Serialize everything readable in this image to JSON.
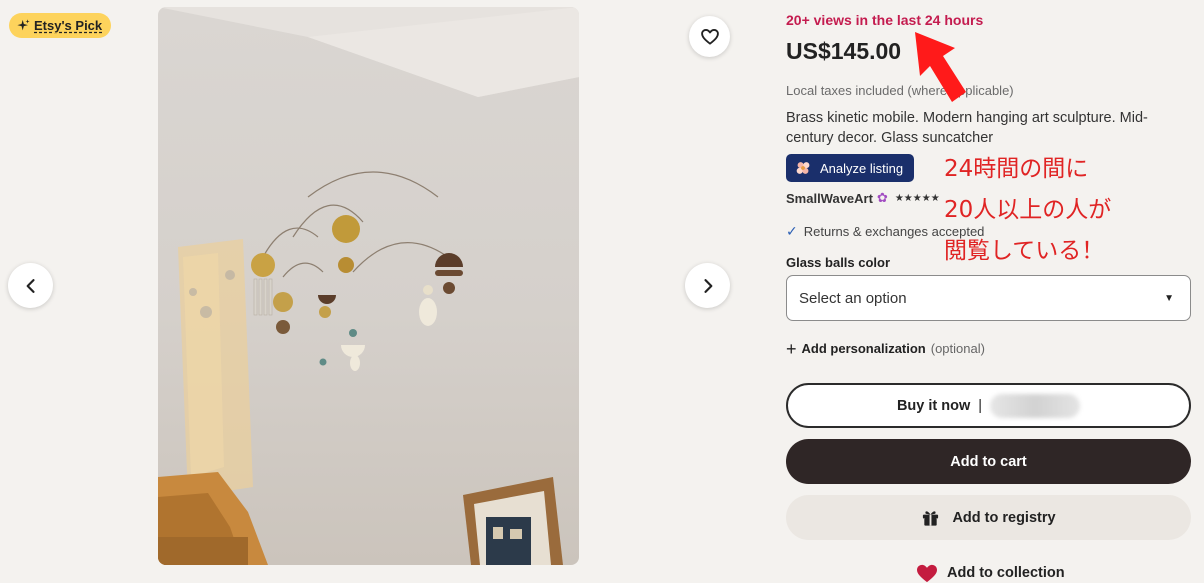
{
  "badge": {
    "label": "Etsy's Pick",
    "icon": "sparkle-icon"
  },
  "gallery": {
    "favorite_icon": "heart-outline-icon",
    "prev_icon": "chevron-left-icon",
    "next_icon": "chevron-right-icon"
  },
  "listing": {
    "views": "20+ views in the last 24 hours",
    "price": "US$145.00",
    "taxes": "Local taxes included (where applicable)",
    "title": "Brass kinetic mobile. Modern hanging art sculpture. Mid-century decor. Glass suncatcher",
    "analyze_label": "Analyze listing",
    "shop_name": "SmallWaveArt",
    "stars": "★★★★★",
    "returns": "Returns & exchanges accepted"
  },
  "options": {
    "label": "Glass balls color",
    "selected": "Select an option"
  },
  "personalization": {
    "label": "Add personalization",
    "optional": "(optional)"
  },
  "actions": {
    "buy_now": "Buy it now",
    "buy_now_sep": "|",
    "add_to_cart": "Add to cart",
    "add_to_registry": "Add to registry",
    "add_to_collection": "Add to collection"
  },
  "annotation": {
    "line1": "24時間の間に",
    "line2": "20人以上の人が",
    "line3": "閲覧している！"
  },
  "colors": {
    "views_red": "#c41c4f",
    "badge_yellow": "#fdd35c",
    "analyze_blue": "#1a2f6b",
    "cart_dark": "#2f2626",
    "annotation_red": "#e02424"
  }
}
